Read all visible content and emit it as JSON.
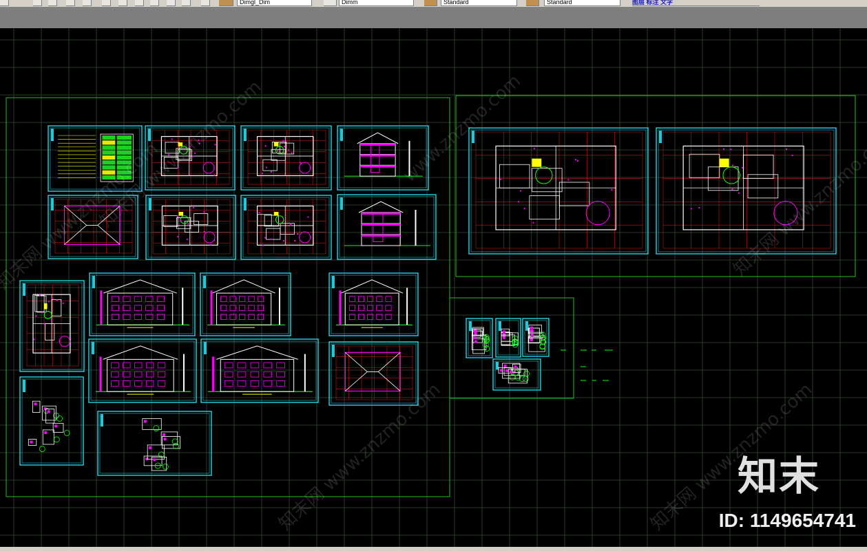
{
  "toolbar": {
    "layer_combo": "Dimgl_Dim",
    "linetype_combo": "Dimm",
    "textstyle_combo": "Standard",
    "dimstyle_combo": "Standard",
    "right_labels": "图层 标注 文字"
  },
  "watermark": {
    "logo": "知末",
    "id": "ID: 1149654741",
    "diagonal": [
      "知末网 www.znzmo.com",
      "知末网 www.znzmo.com",
      "知末网 www.znzmo.com",
      "知末网 www.znzmo.com",
      "知末网 www.znzmo.com",
      "www.znzmo.com"
    ]
  },
  "colors": {
    "background": "#000000",
    "grid": "#2a3a2a",
    "frame_green": "#22c222",
    "sheet_cyan": "#20c8d8",
    "wall_white": "#ffffff",
    "dim_red": "#e02020",
    "fill_magenta": "#ff00ff",
    "text_yellow": "#ffff00",
    "detail_green": "#10ff10"
  }
}
